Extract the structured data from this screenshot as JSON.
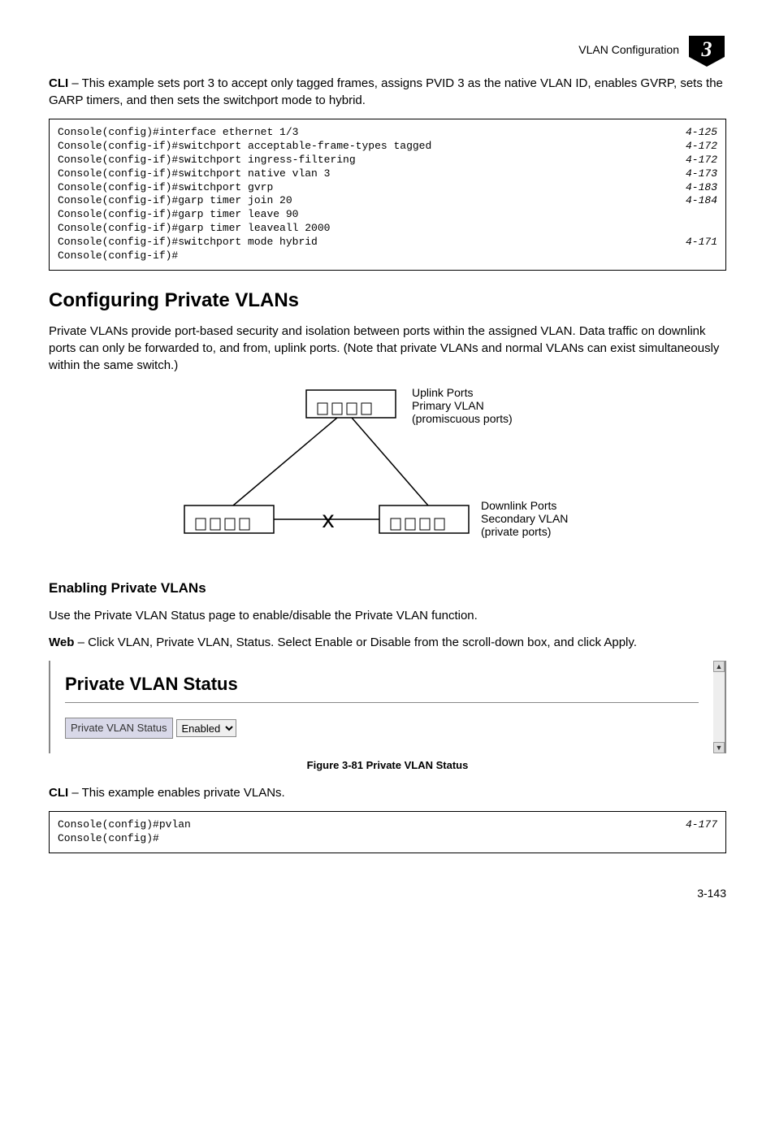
{
  "header": {
    "section_title": "VLAN Configuration",
    "chapter_number": "3"
  },
  "intro_para": {
    "prefix": "CLI",
    "text": " – This example sets port 3 to accept only tagged frames, assigns PVID 3 as the native VLAN ID, enables GVRP, sets the GARP timers, and then sets the switchport mode to hybrid."
  },
  "code_block_1": [
    {
      "cmd": "Console(config)#interface ethernet 1/3",
      "ref": "4-125"
    },
    {
      "cmd": "Console(config-if)#switchport acceptable-frame-types tagged",
      "ref": "4-172"
    },
    {
      "cmd": "Console(config-if)#switchport ingress-filtering",
      "ref": "4-172"
    },
    {
      "cmd": "Console(config-if)#switchport native vlan 3",
      "ref": "4-173"
    },
    {
      "cmd": "Console(config-if)#switchport gvrp",
      "ref": "4-183"
    },
    {
      "cmd": "Console(config-if)#garp timer join 20",
      "ref": "4-184"
    },
    {
      "cmd": "Console(config-if)#garp timer leave 90",
      "ref": ""
    },
    {
      "cmd": "Console(config-if)#garp timer leaveall 2000",
      "ref": ""
    },
    {
      "cmd": "Console(config-if)#switchport mode hybrid",
      "ref": "4-171"
    },
    {
      "cmd": "Console(config-if)#",
      "ref": ""
    }
  ],
  "section_heading": "Configuring Private VLANs",
  "section_para": "Private VLANs provide port-based security and isolation between ports within the assigned VLAN. Data traffic on downlink ports can only be forwarded to, and from, uplink ports. (Note that private VLANs and normal VLANs can exist simultaneously within the same switch.)",
  "diagram": {
    "uplink_label_1": "Uplink Ports",
    "uplink_label_2": "Primary VLAN",
    "uplink_label_3": "(promiscuous ports)",
    "downlink_label_1": "Downlink Ports",
    "downlink_label_2": "Secondary VLAN",
    "downlink_label_3": "(private ports)",
    "x_mark": "x"
  },
  "subsection_heading": "Enabling Private VLANs",
  "subsection_para": "Use the Private VLAN Status page to enable/disable the Private VLAN function.",
  "web_para": {
    "prefix": "Web",
    "text": " – Click VLAN, Private VLAN, Status. Select Enable or Disable from the scroll-down box, and click Apply."
  },
  "screenshot": {
    "title": "Private VLAN Status",
    "field_label": "Private VLAN Status",
    "field_value": "Enabled"
  },
  "figure_caption": "Figure 3-81   Private VLAN Status",
  "cli_para2": {
    "prefix": "CLI",
    "text": " – This example enables private VLANs."
  },
  "code_block_2": [
    {
      "cmd": "Console(config)#pvlan",
      "ref": "4-177"
    },
    {
      "cmd": "Console(config)#",
      "ref": ""
    }
  ],
  "page_number": "3-143"
}
